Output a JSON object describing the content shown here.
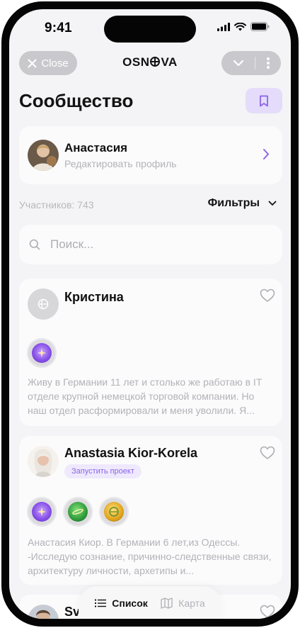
{
  "status_bar": {
    "time": "9:41"
  },
  "nav": {
    "close_label": "Close",
    "brand_left": "OSN",
    "brand_right": "VA"
  },
  "page": {
    "title": "Сообщество"
  },
  "profile": {
    "name": "Анастасия",
    "subtitle": "Редактировать профиль"
  },
  "members_count": "Участников: 743",
  "filters_label": "Фильтры",
  "search": {
    "placeholder": "Поиск..."
  },
  "members": [
    {
      "name": "Кристина",
      "tag": "",
      "badges": [
        "purple-sparkle-badge"
      ],
      "description": "Живу в Германии 11 лет и столько же работаю в IT отделе крупной немецкой торговой компании. Но наш отдел расформировали и меня уволили. Я..."
    },
    {
      "name": "Anastasia Kior-Korela",
      "tag": "Запустить проект",
      "badges": [
        "purple-sparkle-badge",
        "green-planet-badge",
        "gold-globe-badge"
      ],
      "description": "Анастасия Киор. В Германии 6 лет,из Одессы. -Исследую сознание, причинно-следственные связи, архитектуру личности, архетипы и..."
    },
    {
      "name": "Sv",
      "tag": "",
      "badges": [],
      "description": ""
    }
  ],
  "tabs": [
    {
      "label": "Список",
      "active": true
    },
    {
      "label": "Карта",
      "active": false
    }
  ],
  "colors": {
    "accent": "#8c63e8",
    "accent_bg": "#e4dcfa",
    "background": "#f4f4f6",
    "card": "#fbfbfc",
    "muted_text": "#b3b3b8"
  }
}
